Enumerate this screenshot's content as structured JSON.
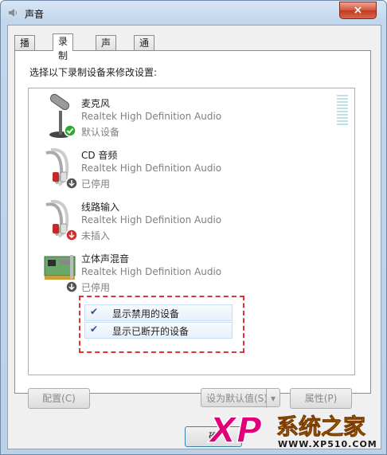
{
  "window": {
    "title": "声音",
    "close_glyph": "×"
  },
  "tabs": [
    {
      "label": "播放"
    },
    {
      "label": "录制"
    },
    {
      "label": "声音"
    },
    {
      "label": "通信"
    }
  ],
  "instruction": "选择以下录制设备来修改设置:",
  "devices": [
    {
      "name": "麦克风",
      "driver": "Realtek High Definition Audio",
      "status": "默认设备",
      "icon": "microphone-icon",
      "badge": "green-check"
    },
    {
      "name": "CD 音频",
      "driver": "Realtek High Definition Audio",
      "status": "已停用",
      "icon": "cd-audio-rca-cable-icon",
      "badge": "grey-down-arrow"
    },
    {
      "name": "线路输入",
      "driver": "Realtek High Definition Audio",
      "status": "未插入",
      "icon": "line-in-rca-cable-icon",
      "badge": "red-down-arrow"
    },
    {
      "name": "立体声混音",
      "driver": "Realtek High Definition Audio",
      "status": "已停用",
      "icon": "sound-card-icon",
      "badge": "grey-down-arrow"
    }
  ],
  "context_menu": {
    "items": [
      {
        "label": "显示禁用的设备",
        "checked": true
      },
      {
        "label": "显示已断开的设备",
        "checked": true
      }
    ],
    "highlight_color": "#e03434"
  },
  "buttons": {
    "configure": "配置(C)",
    "set_default": "设为默认值(S)",
    "properties": "属性(P)",
    "ok_partial": "确"
  },
  "watermark": {
    "brand": "XP",
    "site_name": "系统之家",
    "url": "WWW.XP510.COM"
  }
}
